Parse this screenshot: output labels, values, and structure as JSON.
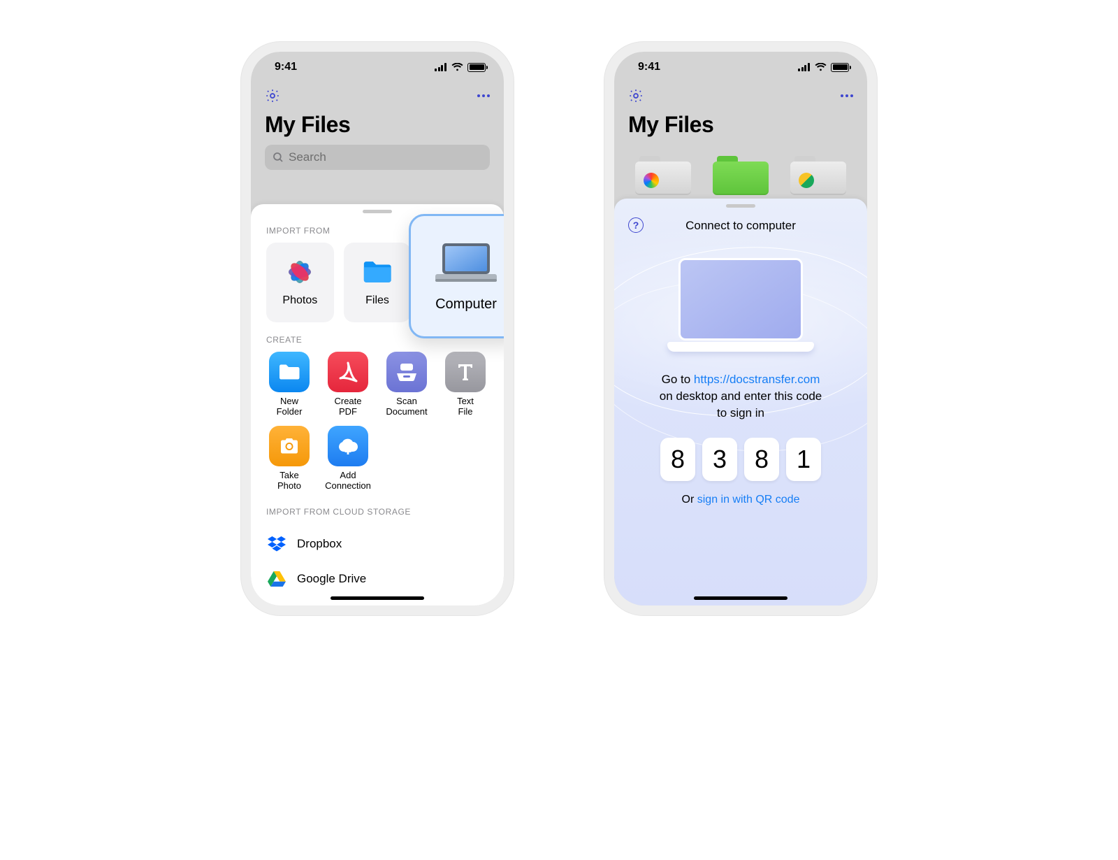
{
  "status": {
    "time": "9:41"
  },
  "header": {
    "title": "My Files",
    "search_placeholder": "Search"
  },
  "sheetA": {
    "import_section": "IMPORT FROM",
    "import_items": [
      {
        "label": "Photos"
      },
      {
        "label": "Files"
      },
      {
        "label": "Computer"
      }
    ],
    "create_section": "CREATE",
    "create_items": [
      {
        "line1": "New",
        "line2": "Folder"
      },
      {
        "line1": "Create",
        "line2": "PDF"
      },
      {
        "line1": "Scan",
        "line2": "Document"
      },
      {
        "line1": "Text",
        "line2": "File"
      },
      {
        "line1": "Take",
        "line2": "Photo"
      },
      {
        "line1": "Add",
        "line2": "Connection"
      }
    ],
    "cloud_section": "IMPORT FROM CLOUD STORAGE",
    "cloud_items": [
      {
        "label": "Dropbox"
      },
      {
        "label": "Google Drive"
      }
    ]
  },
  "sheetB": {
    "title": "Connect to computer",
    "instr_pre": "Go to ",
    "instr_url": "https://docstransfer.com",
    "instr_post1": "on desktop and enter this code",
    "instr_post2": "to sign in",
    "code": [
      "8",
      "3",
      "8",
      "1"
    ],
    "or_pre": "Or ",
    "or_link": "sign in with QR code"
  }
}
